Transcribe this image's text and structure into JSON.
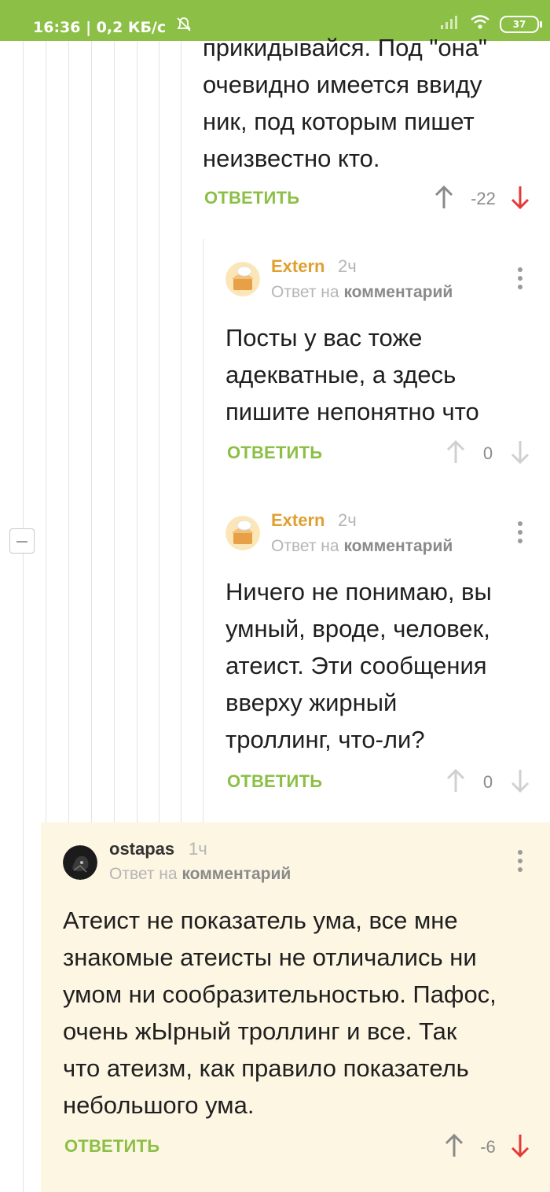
{
  "status_bar": {
    "time_speed": "16:36 | 0,2 КБ/с",
    "battery": "37"
  },
  "comments": [
    {
      "text_lines": [
        "прикидывайся. Под \"она\"",
        "очевидно имеется ввиду",
        "ник, под которым пишет",
        "неизвестно кто."
      ],
      "reply_label": "ОТВЕТИТЬ",
      "rating": "-22"
    },
    {
      "author": "Extern",
      "time": "2ч",
      "reply_prefix": "Ответ на",
      "reply_target": "комментарий",
      "text_lines": [
        "Посты у вас тоже",
        "адекватные, а здесь",
        "пишите непонятно что"
      ],
      "reply_label": "ОТВЕТИТЬ",
      "rating": "0"
    },
    {
      "author": "Extern",
      "time": "2ч",
      "reply_prefix": "Ответ на",
      "reply_target": "комментарий",
      "text_lines": [
        "Ничего не понимаю, вы",
        "умный, вроде, человек,",
        "атеист. Эти сообщения",
        "вверху жирный",
        "троллинг, что-ли?"
      ],
      "reply_label": "ОТВЕТИТЬ",
      "rating": "0"
    },
    {
      "author": "ostapas",
      "time": "1ч",
      "reply_prefix": "Ответ на",
      "reply_target": "комментарий",
      "text_lines": [
        "Атеист не показатель ума, все мне",
        "знакомые атеисты не отличались ни",
        "умом ни сообразительностью. Пафос,",
        "очень жЫрный троллинг и все. Так",
        "что атеизм, как правило показатель",
        "небольшого ума."
      ],
      "reply_label": "ОТВЕТИТЬ",
      "rating": "-6"
    }
  ],
  "colors": {
    "accent_green": "#8cbf46",
    "author_orange": "#e0a030",
    "downvote_red": "#e53935",
    "highlight_bg": "#fdf6e3"
  },
  "icons": [
    "wifi-icon",
    "signal-icon",
    "bell-muted-icon",
    "upvote-arrow-icon",
    "downvote-arrow-icon",
    "more-icon",
    "collapse-icon"
  ]
}
